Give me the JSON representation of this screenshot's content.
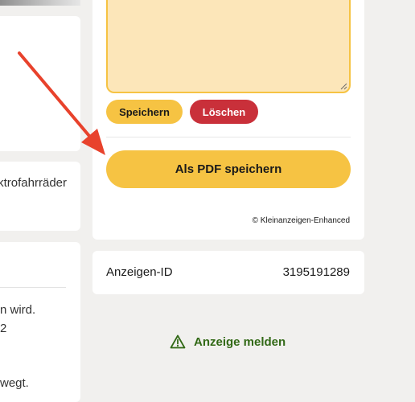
{
  "left_column": {
    "line_1": "ktrofahrräder",
    "line_2": "n wird.",
    "line_3": "2",
    "line_4": "wegt."
  },
  "notes": {
    "save_label": "Speichern",
    "delete_label": "Löschen"
  },
  "pdf_button_label": "Als PDF speichern",
  "copyright": "© Kleinanzeigen-Enhanced",
  "ad_id": {
    "label": "Anzeigen-ID",
    "value": "3195191289"
  },
  "report": {
    "label": "Anzeige melden"
  },
  "colors": {
    "accent_yellow": "#f6c343",
    "notes_background": "#fce6b9",
    "delete_red": "#c9303a",
    "report_green": "#326916",
    "arrow_red": "#e8422c",
    "page_background": "#f1f0ee"
  },
  "icons": {
    "report": "warning-triangle-icon",
    "annotation": "red-arrow-annotation"
  }
}
